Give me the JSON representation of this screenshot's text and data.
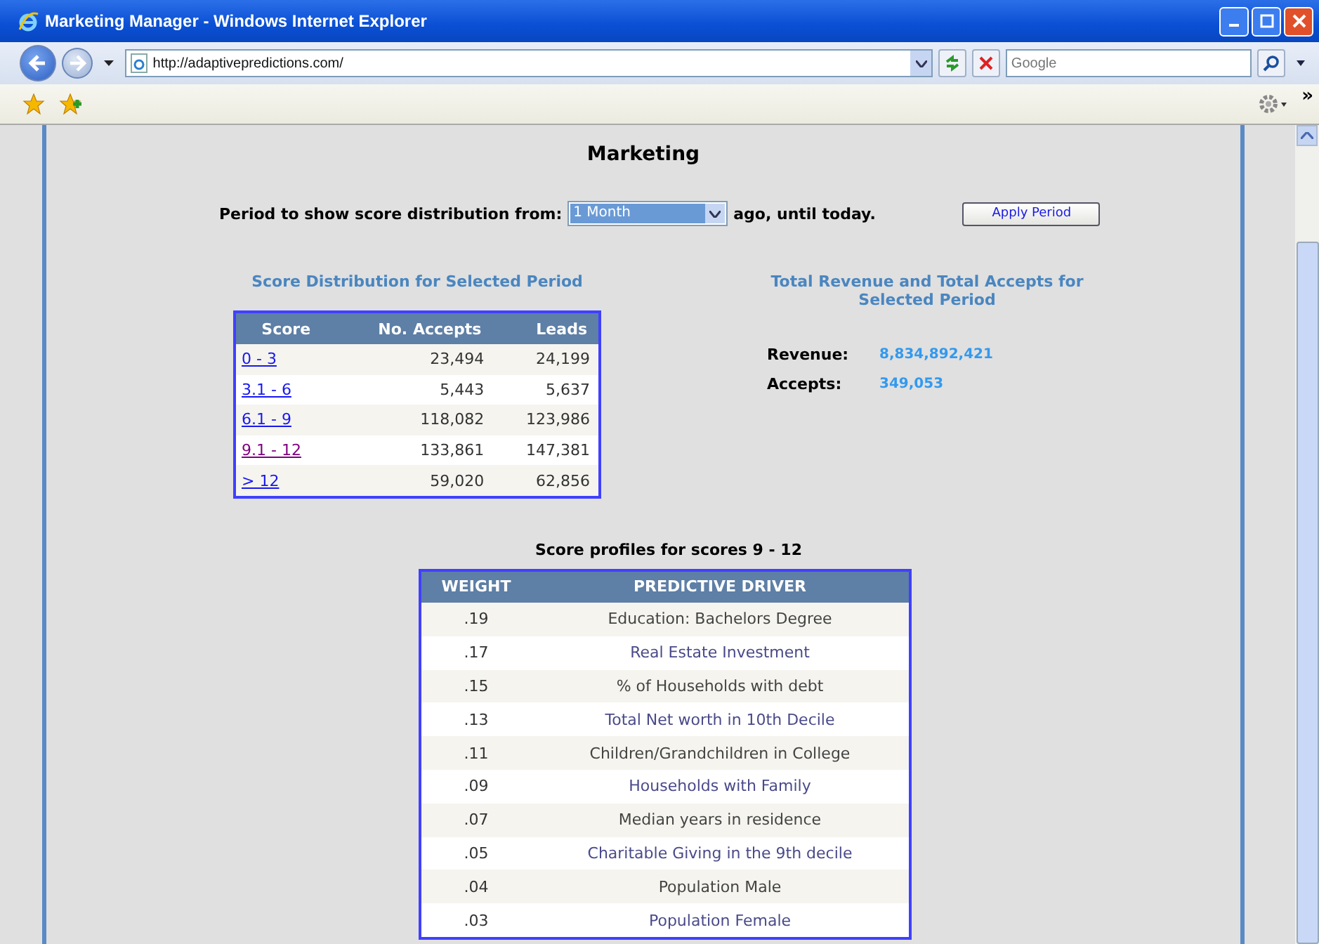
{
  "window": {
    "title": "Marketing Manager - Windows Internet Explorer"
  },
  "address_bar": {
    "url": "http://adaptivepredictions.com/"
  },
  "search": {
    "placeholder": "Google"
  },
  "toolbar": {
    "overflow": "»"
  },
  "page": {
    "title": "Marketing",
    "period": {
      "label": "Period to show score distribution from:",
      "value": "1 Month",
      "suffix": "ago, until today.",
      "button": "Apply Period"
    },
    "distribution": {
      "title": "Score Distribution for Selected Period",
      "columns": [
        "Score",
        "No. Accepts",
        "Leads"
      ],
      "rows": [
        {
          "score": "0 - 3",
          "visited": false,
          "accepts": "23,494",
          "leads": "24,199"
        },
        {
          "score": "3.1 - 6",
          "visited": false,
          "accepts": "5,443",
          "leads": "5,637"
        },
        {
          "score": "6.1 - 9",
          "visited": false,
          "accepts": "118,082",
          "leads": "123,986"
        },
        {
          "score": "9.1 - 12",
          "visited": true,
          "accepts": "133,861",
          "leads": "147,381"
        },
        {
          "score": "> 12",
          "visited": false,
          "accepts": "59,020",
          "leads": "62,856"
        }
      ]
    },
    "totals": {
      "title": "Total Revenue and Total Accepts for Selected Period",
      "items": [
        {
          "label": "Revenue:",
          "value": "8,834,892,421"
        },
        {
          "label": "Accepts:",
          "value": "349,053"
        }
      ]
    },
    "profiles": {
      "title": "Score profiles for scores 9 - 12",
      "columns": [
        "WEIGHT",
        "PREDICTIVE DRIVER"
      ],
      "rows": [
        {
          "weight": ".19",
          "driver": "Education: Bachelors Degree"
        },
        {
          "weight": ".17",
          "driver": "Real Estate Investment"
        },
        {
          "weight": ".15",
          "driver": "% of Households with debt"
        },
        {
          "weight": ".13",
          "driver": "Total Net worth in 10th Decile"
        },
        {
          "weight": ".11",
          "driver": "Children/Grandchildren in College"
        },
        {
          "weight": ".09",
          "driver": "Households with Family"
        },
        {
          "weight": ".07",
          "driver": "Median years in residence"
        },
        {
          "weight": ".05",
          "driver": "Charitable Giving in the 9th decile"
        },
        {
          "weight": ".04",
          "driver": "Population Male"
        },
        {
          "weight": ".03",
          "driver": "Population Female"
        }
      ]
    }
  }
}
